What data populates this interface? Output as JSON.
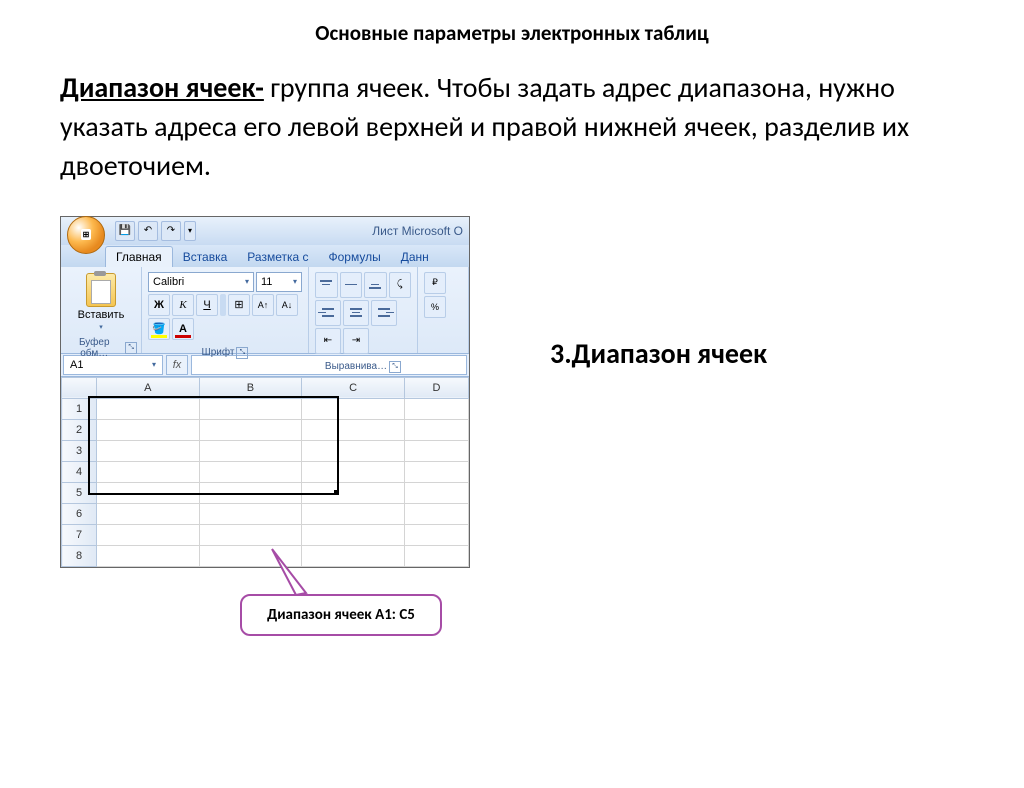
{
  "title": "Основные параметры электронных таблиц",
  "body": {
    "term": "Диапазон ячеек-",
    "rest": " группа ячеек. Чтобы задать адрес диапазона, нужно указать адреса его левой верхней и правой нижней ячеек,  разделив их двоеточием."
  },
  "section_label": "3.Диапазон ячеек",
  "callout": "Диапазон ячеек A1: С5",
  "excel": {
    "window_title": "Лист Microsoft O",
    "tabs": [
      "Главная",
      "Вставка",
      "Разметка с",
      "Формулы",
      "Данн"
    ],
    "active_tab": 0,
    "paste_label": "Вставить",
    "font_name": "Calibri",
    "font_size": "11",
    "group_clipboard": "Буфер обм…",
    "group_font": "Шрифт",
    "group_align": "Выравнива…",
    "namebox": "A1",
    "cols": [
      "A",
      "B",
      "C",
      "D"
    ],
    "rows": [
      "1",
      "2",
      "3",
      "4",
      "5",
      "6",
      "7",
      "8"
    ]
  }
}
